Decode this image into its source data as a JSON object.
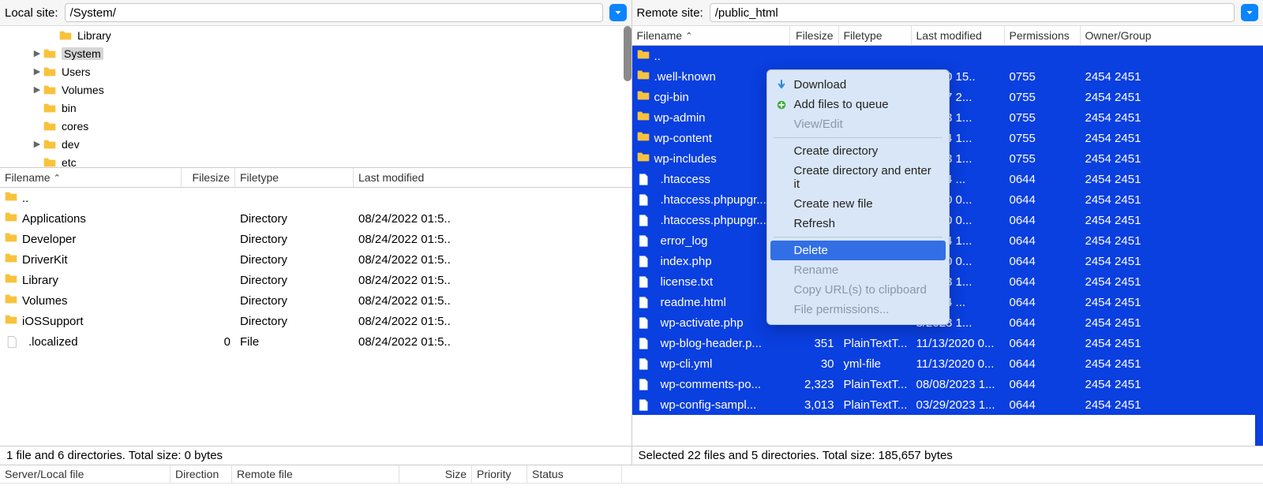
{
  "local": {
    "path_label": "Local site:",
    "path_value": "/System/",
    "tree_items": [
      {
        "indent": 2,
        "caret": "",
        "name": "Library"
      },
      {
        "indent": 1,
        "caret": "▶",
        "name": "System",
        "selected": true
      },
      {
        "indent": 1,
        "caret": "▶",
        "name": "Users"
      },
      {
        "indent": 1,
        "caret": "▶",
        "name": "Volumes"
      },
      {
        "indent": 1,
        "caret": "",
        "name": "bin"
      },
      {
        "indent": 1,
        "caret": "",
        "name": "cores"
      },
      {
        "indent": 1,
        "caret": "▶",
        "name": "dev"
      },
      {
        "indent": 1,
        "caret": "",
        "name": "etc"
      }
    ],
    "headers": {
      "name": "Filename",
      "size": "Filesize",
      "type": "Filetype",
      "mod": "Last modified"
    },
    "rows": [
      {
        "icon": "folder",
        "name": "..",
        "size": "",
        "type": "",
        "mod": ""
      },
      {
        "icon": "folder",
        "name": "Applications",
        "size": "",
        "type": "Directory",
        "mod": "08/24/2022 01:5.."
      },
      {
        "icon": "folder",
        "name": "Developer",
        "size": "",
        "type": "Directory",
        "mod": "08/24/2022 01:5.."
      },
      {
        "icon": "folder",
        "name": "DriverKit",
        "size": "",
        "type": "Directory",
        "mod": "08/24/2022 01:5.."
      },
      {
        "icon": "folder",
        "name": "Library",
        "size": "",
        "type": "Directory",
        "mod": "08/24/2022 01:5.."
      },
      {
        "icon": "folder",
        "name": "Volumes",
        "size": "",
        "type": "Directory",
        "mod": "08/24/2022 01:5.."
      },
      {
        "icon": "folder",
        "name": "iOSSupport",
        "size": "",
        "type": "Directory",
        "mod": "08/24/2022 01:5.."
      },
      {
        "icon": "file",
        "name": ".localized",
        "size": "0",
        "type": "File",
        "mod": "08/24/2022 01:5.."
      }
    ],
    "status": "1 file and 6 directories. Total size: 0 bytes"
  },
  "remote": {
    "path_label": "Remote site:",
    "path_value": "/public_html",
    "headers": {
      "name": "Filename",
      "size": "Filesize",
      "type": "Filetype",
      "mod": "Last modified",
      "perm": "Permissions",
      "own": "Owner/Group"
    },
    "rows": [
      {
        "icon": "folder",
        "name": "..",
        "size": "",
        "type": "",
        "mod": "",
        "perm": "",
        "own": ""
      },
      {
        "icon": "folder",
        "name": ".well-known",
        "size": "",
        "type": "",
        "mod": "3/2020 15..",
        "perm": "0755",
        "own": "2454 2451"
      },
      {
        "icon": "folder",
        "name": "cgi-bin",
        "size": "",
        "type": "",
        "mod": "2/2017 2...",
        "perm": "0755",
        "own": "2454 2451"
      },
      {
        "icon": "folder",
        "name": "wp-admin",
        "size": "",
        "type": "",
        "mod": "8/2023 1...",
        "perm": "0755",
        "own": "2454 2451"
      },
      {
        "icon": "folder",
        "name": "wp-content",
        "size": "",
        "type": "",
        "mod": "9/2024 1...",
        "perm": "0755",
        "own": "2454 2451"
      },
      {
        "icon": "folder",
        "name": "wp-includes",
        "size": "",
        "type": "",
        "mod": "7/2023 1...",
        "perm": "0755",
        "own": "2454 2451"
      },
      {
        "icon": "file",
        "name": ".htaccess",
        "size": "",
        "type": "",
        "mod": "8/2024 ...",
        "perm": "0644",
        "own": "2454 2451"
      },
      {
        "icon": "file",
        "name": ".htaccess.phpupgr...",
        "size": "",
        "type": "",
        "mod": "7/2020 0...",
        "perm": "0644",
        "own": "2454 2451"
      },
      {
        "icon": "file",
        "name": ".htaccess.phpupgr...",
        "size": "",
        "type": "",
        "mod": "7/2020 0...",
        "perm": "0644",
        "own": "2454 2451"
      },
      {
        "icon": "file",
        "name": "error_log",
        "size": "",
        "type": "",
        "mod": "7/2024 1...",
        "perm": "0644",
        "own": "2454 2451"
      },
      {
        "icon": "file",
        "name": "index.php",
        "size": "",
        "type": "",
        "mod": "7/2020 0...",
        "perm": "0644",
        "own": "2454 2451"
      },
      {
        "icon": "file",
        "name": "license.txt",
        "size": "",
        "type": "",
        "mod": "7/2023 1...",
        "perm": "0644",
        "own": "2454 2451"
      },
      {
        "icon": "file",
        "name": "readme.html",
        "size": "",
        "type": "",
        "mod": "0/2024 ...",
        "perm": "0644",
        "own": "2454 2451"
      },
      {
        "icon": "file",
        "name": "wp-activate.php",
        "size": "",
        "type": "",
        "mod": "8/2023 1...",
        "perm": "0644",
        "own": "2454 2451"
      },
      {
        "icon": "file",
        "name": "wp-blog-header.p...",
        "size": "351",
        "type": "PlainTextT...",
        "mod": "11/13/2020 0...",
        "perm": "0644",
        "own": "2454 2451"
      },
      {
        "icon": "file",
        "name": "wp-cli.yml",
        "size": "30",
        "type": "yml-file",
        "mod": "11/13/2020 0...",
        "perm": "0644",
        "own": "2454 2451"
      },
      {
        "icon": "file",
        "name": "wp-comments-po...",
        "size": "2,323",
        "type": "PlainTextT...",
        "mod": "08/08/2023 1...",
        "perm": "0644",
        "own": "2454 2451"
      },
      {
        "icon": "file",
        "name": "wp-config-sampl...",
        "size": "3,013",
        "type": "PlainTextT...",
        "mod": "03/29/2023 1...",
        "perm": "0644",
        "own": "2454 2451"
      }
    ],
    "status": "Selected 22 files and 5 directories. Total size: 185,657 bytes"
  },
  "context_menu": {
    "download": "Download",
    "add_queue": "Add files to queue",
    "view_edit": "View/Edit",
    "create_dir": "Create directory",
    "create_dir_enter": "Create directory and enter it",
    "create_file": "Create new file",
    "refresh": "Refresh",
    "delete": "Delete",
    "rename": "Rename",
    "copy_url": "Copy URL(s) to clipboard",
    "file_perms": "File permissions..."
  },
  "queue_headers": {
    "server": "Server/Local file",
    "direction": "Direction",
    "remote": "Remote file",
    "size": "Size",
    "priority": "Priority",
    "status": "Status"
  }
}
